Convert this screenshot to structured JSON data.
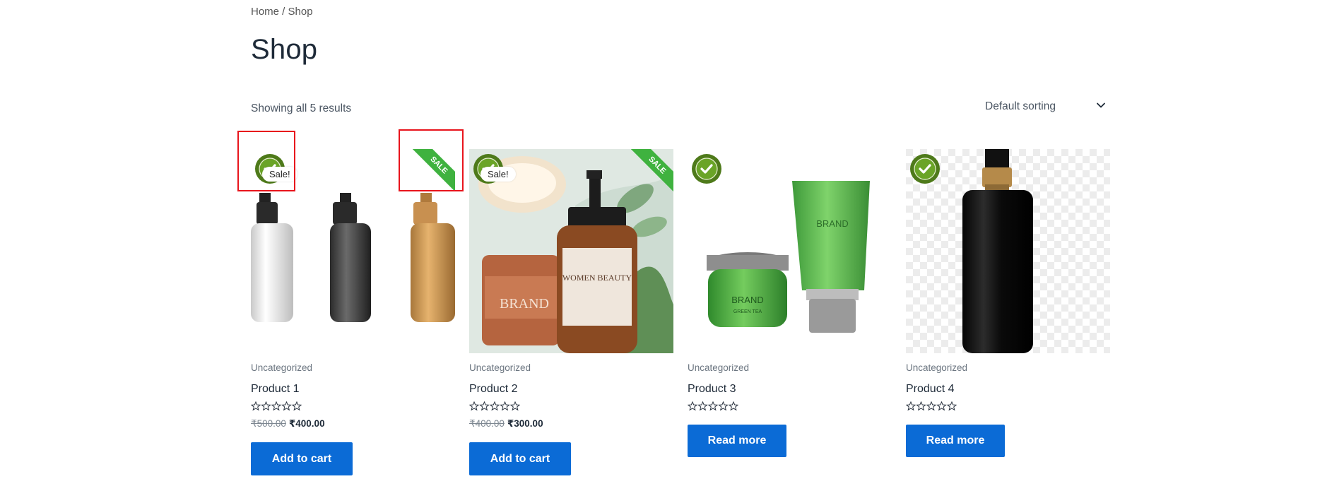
{
  "breadcrumb": {
    "home": "Home",
    "separator": " / ",
    "current": "Shop"
  },
  "page_title": "Shop",
  "result_count": "Showing all 5 results",
  "sorting": {
    "selected": "Default sorting"
  },
  "badges": {
    "sale_pill": "Sale!",
    "sale_corner": "SALE"
  },
  "colors": {
    "accent": "#0b6bd6",
    "sale_green": "#3fb23f",
    "highlight_red": "#e8141c",
    "title": "#1e2a38"
  },
  "products": [
    {
      "category": "Uncategorized",
      "name": "Product 1",
      "rating": 0,
      "price_old": "₹500.00",
      "price_new": "₹400.00",
      "button": "Add to cart",
      "on_sale": true
    },
    {
      "category": "Uncategorized",
      "name": "Product 2",
      "rating": 0,
      "price_old": "₹400.00",
      "price_new": "₹300.00",
      "button": "Add to cart",
      "on_sale": true,
      "image_text": {
        "brand": "BRAND",
        "label": "WOMEN BEAUTY"
      }
    },
    {
      "category": "Uncategorized",
      "name": "Product 3",
      "rating": 0,
      "button": "Read more",
      "on_sale": false,
      "image_text": {
        "brand": "BRAND",
        "sub": "GREEN TEA"
      }
    },
    {
      "category": "Uncategorized",
      "name": "Product 4",
      "rating": 0,
      "button": "Read more",
      "on_sale": false
    }
  ]
}
